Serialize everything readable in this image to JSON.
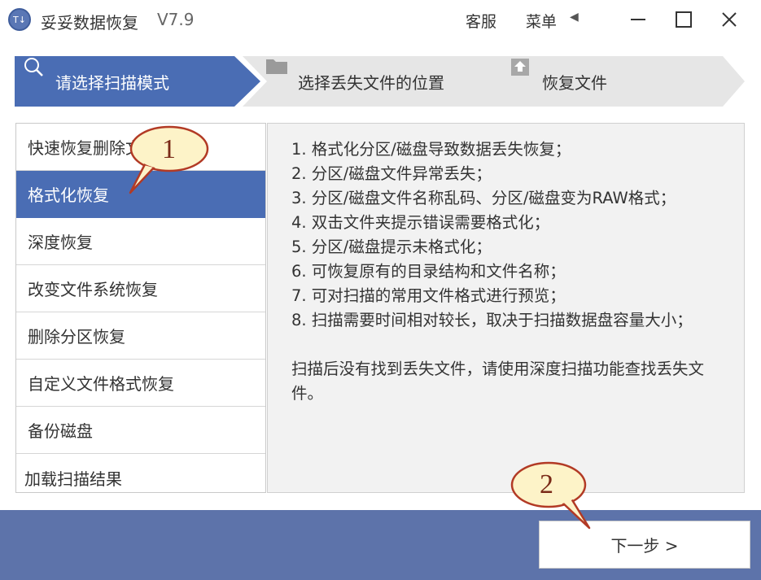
{
  "titlebar": {
    "app_title": "妥妥数据恢复",
    "version": "V7.9",
    "logo_text": "T↓",
    "support_label": "客服",
    "menu_label": "菜单",
    "menu_arrow": "◀"
  },
  "steps": [
    {
      "label": "请选择扫描模式",
      "icon": "search-icon",
      "active": true
    },
    {
      "label": "选择丢失文件的位置",
      "icon": "folder-icon",
      "active": false
    },
    {
      "label": "恢复文件",
      "icon": "upload-icon",
      "active": false
    }
  ],
  "modes": [
    {
      "label": "快速恢复删除文件"
    },
    {
      "label": "格式化恢复",
      "selected": true
    },
    {
      "label": "深度恢复"
    },
    {
      "label": "改变文件系统恢复"
    },
    {
      "label": "删除分区恢复"
    },
    {
      "label": "自定义文件格式恢复"
    },
    {
      "label": "备份磁盘"
    },
    {
      "label": "加载扫描结果"
    }
  ],
  "description": {
    "lines": [
      "1. 格式化分区/磁盘导致数据丢失恢复；",
      "2. 分区/磁盘文件异常丢失；",
      "3. 分区/磁盘文件名称乱码、分区/磁盘变为RAW格式；",
      "4. 双击文件夹提示错误需要格式化；",
      "5. 分区/磁盘提示未格式化；",
      "6. 可恢复原有的目录结构和文件名称；",
      "7. 可对扫描的常用文件格式进行预览；",
      "8. 扫描需要时间相对较长，取决于扫描数据盘容量大小；"
    ],
    "note": "扫描后没有找到丢失文件，请使用深度扫描功能查找丢失文件。"
  },
  "footer": {
    "next_label": "下一步 >"
  },
  "callouts": [
    {
      "label": "1"
    },
    {
      "label": "2"
    }
  ],
  "colors": {
    "accent": "#4a6db4",
    "footer": "#5d73aa",
    "step_inactive": "#e6e6e6",
    "callout_fill": "#fdf3c8",
    "callout_border": "#b23a25"
  }
}
